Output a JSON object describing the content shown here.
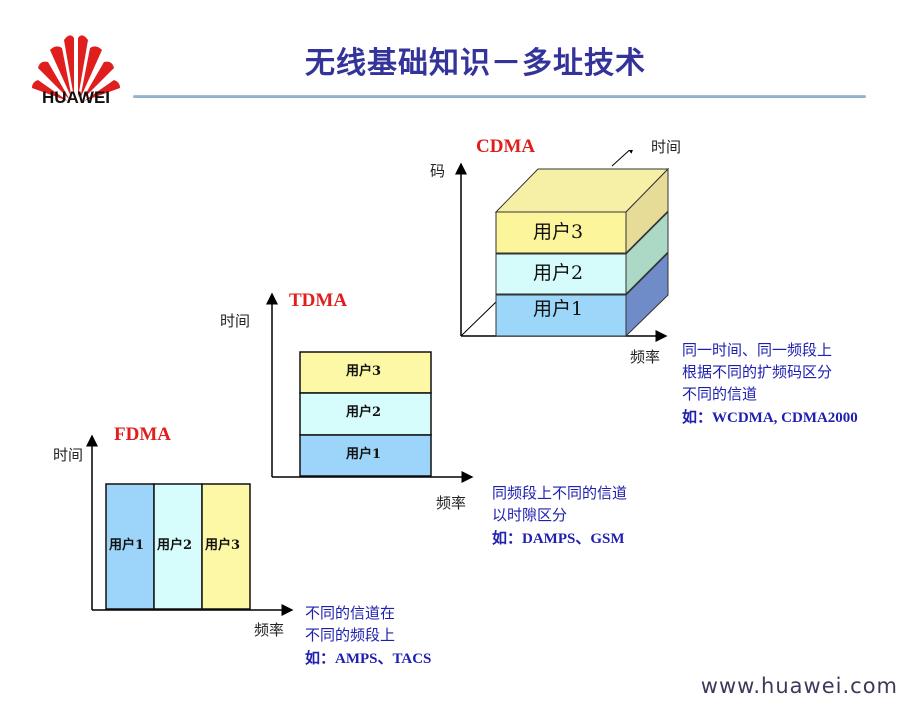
{
  "header": {
    "brand": "HUAWEI",
    "title": "无线基础知识－多址技术",
    "colors": {
      "title": "#33339a",
      "logo": "#e01e1e",
      "rule": "#8fb1c8"
    }
  },
  "diagrams": {
    "cdma": {
      "name": "CDMA",
      "axes": {
        "y": "码",
        "x": "频率",
        "z": "时间"
      },
      "layers": [
        {
          "label": "用户3",
          "color": "#fdf59c"
        },
        {
          "label": "用户2",
          "color": "#d6fbfb"
        },
        {
          "label": "用户1",
          "color": "#9cd6f8"
        }
      ],
      "description": [
        "同一时间、同一频段上",
        "根据不同的扩频码区分",
        "不同的信道"
      ],
      "example": "如：WCDMA, CDMA2000"
    },
    "tdma": {
      "name": "TDMA",
      "axes": {
        "y": "时间",
        "x": "频率"
      },
      "slots": [
        {
          "label": "用户3",
          "color": "#fdf8a6"
        },
        {
          "label": "用户2",
          "color": "#d6fcfc"
        },
        {
          "label": "用户1",
          "color": "#9cd5f9"
        }
      ],
      "description": [
        "同频段上不同的信道",
        "以时隙区分"
      ],
      "example": "如：DAMPS、GSM"
    },
    "fdma": {
      "name": "FDMA",
      "axes": {
        "y": "时间",
        "x": "频率"
      },
      "bands": [
        {
          "label": "用户1",
          "color": "#9cd5f9"
        },
        {
          "label": "用户2",
          "color": "#d6fcfc"
        },
        {
          "label": "用户3",
          "color": "#fdf8a6"
        }
      ],
      "description": [
        "不同的信道在",
        "不同的频段上"
      ],
      "example": "如：AMPS、TACS"
    }
  },
  "footer": {
    "url": "www.huawei.com"
  }
}
